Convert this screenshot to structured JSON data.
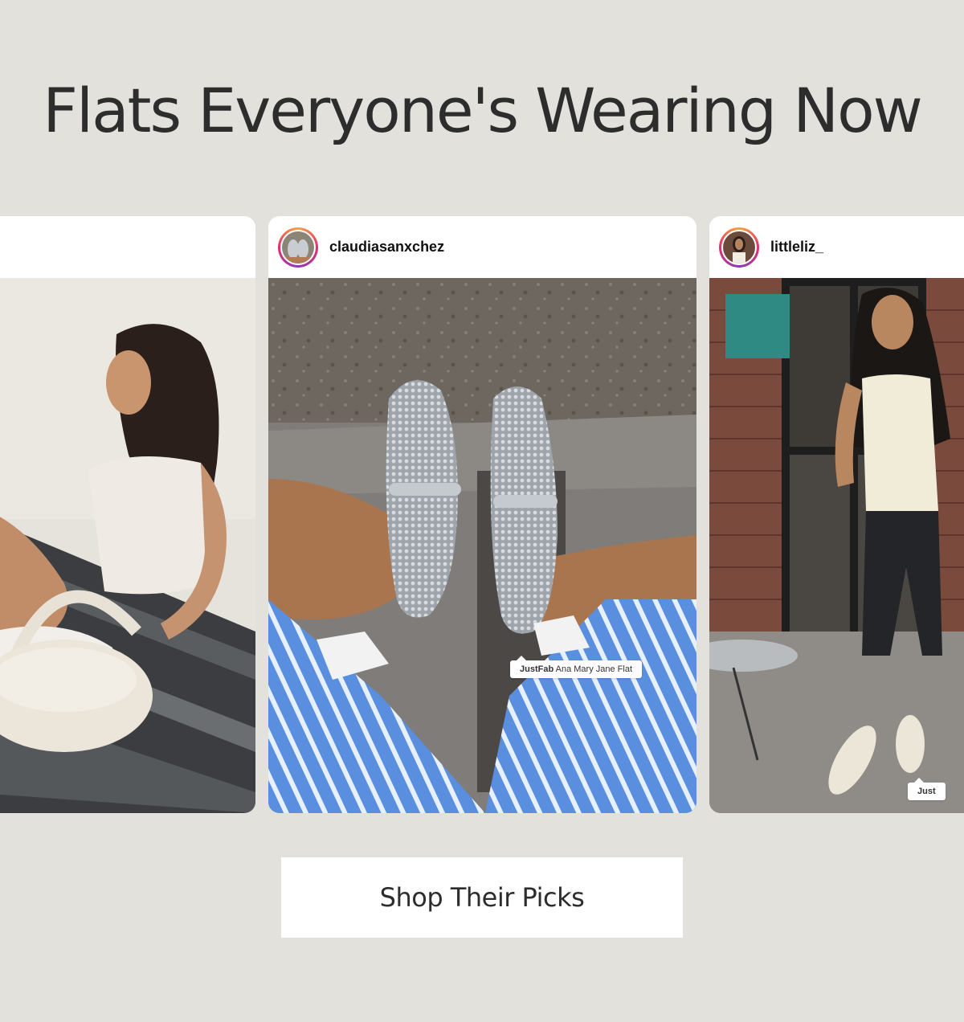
{
  "header": {
    "title": "Flats Everyone's Wearing Now"
  },
  "posts": [
    {
      "username": "",
      "product_tag": {
        "brand": "",
        "name": ""
      }
    },
    {
      "username": "claudiasanxchez",
      "product_tag": {
        "brand": "JustFab",
        "name": "Ana Mary Jane Flat"
      }
    },
    {
      "username": "littleliz_",
      "product_tag": {
        "brand": "Just",
        "name": ""
      }
    }
  ],
  "cta": {
    "label": "Shop Their Picks"
  },
  "colors": {
    "background": "#e2e1dc",
    "card": "#ffffff",
    "text": "#2d2d2d",
    "avatar_ring": [
      "#f9a23b",
      "#e1306c",
      "#8a3ab9"
    ]
  }
}
